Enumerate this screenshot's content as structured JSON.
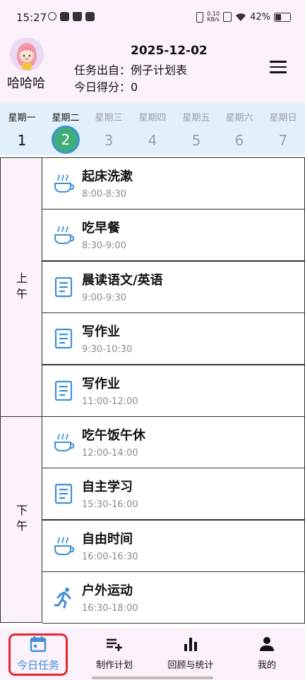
{
  "status_bar": {
    "time": "15:27",
    "speed_value": "0.10",
    "speed_unit": "KB/s",
    "battery": "42%"
  },
  "header": {
    "user_name": "哈哈哈",
    "date": "2025-12-02",
    "source": "任务出自：例子计划表",
    "score": "今日得分：0"
  },
  "week": {
    "days": [
      {
        "name": "星期一",
        "num": "1"
      },
      {
        "name": "星期二",
        "num": "2"
      },
      {
        "name": "星期三",
        "num": "3"
      },
      {
        "name": "星期四",
        "num": "4"
      },
      {
        "name": "星期五",
        "num": "5"
      },
      {
        "name": "星期六",
        "num": "6"
      },
      {
        "name": "星期日",
        "num": "7"
      }
    ],
    "active_index": 1
  },
  "schedule": {
    "periods": [
      {
        "label_line1": "上",
        "label_line2": "午"
      },
      {
        "label_line1": "下",
        "label_line2": "午"
      }
    ],
    "tasks": [
      {
        "title": "起床洗漱",
        "time": "8:00-8:30",
        "icon": "cup-icon"
      },
      {
        "title": "吃早餐",
        "time": "8:30-9:00",
        "icon": "cup-icon"
      },
      {
        "title": "晨读语文/英语",
        "time": "9:00-9:30",
        "icon": "book-icon"
      },
      {
        "title": "写作业",
        "time": "9:30-10:30",
        "icon": "book-icon"
      },
      {
        "title": "写作业",
        "time": "11:00-12:00",
        "icon": "book-icon"
      },
      {
        "title": "吃午饭午休",
        "time": "12:00-14:00",
        "icon": "cup-icon"
      },
      {
        "title": "自主学习",
        "time": "15:30-16:00",
        "icon": "book-icon"
      },
      {
        "title": "自由时间",
        "time": "16:00-16:30",
        "icon": "cup-icon"
      },
      {
        "title": "户外运动",
        "time": "16:30-18:00",
        "icon": "running-icon"
      }
    ]
  },
  "bottom_nav": {
    "items": [
      {
        "label": "今日任务",
        "icon": "calendar-icon"
      },
      {
        "label": "制作计划",
        "icon": "playlist-add-icon"
      },
      {
        "label": "回顾与统计",
        "icon": "bar-chart-icon"
      },
      {
        "label": "我的",
        "icon": "person-icon"
      }
    ],
    "active_index": 0
  },
  "colors": {
    "accent_blue": "#3f8fd6",
    "active_day_fill": "#3fae78",
    "header_bg": "#fbf1fb",
    "weekbar_bg": "#e2f0fb",
    "highlight_red": "#e0282f"
  }
}
